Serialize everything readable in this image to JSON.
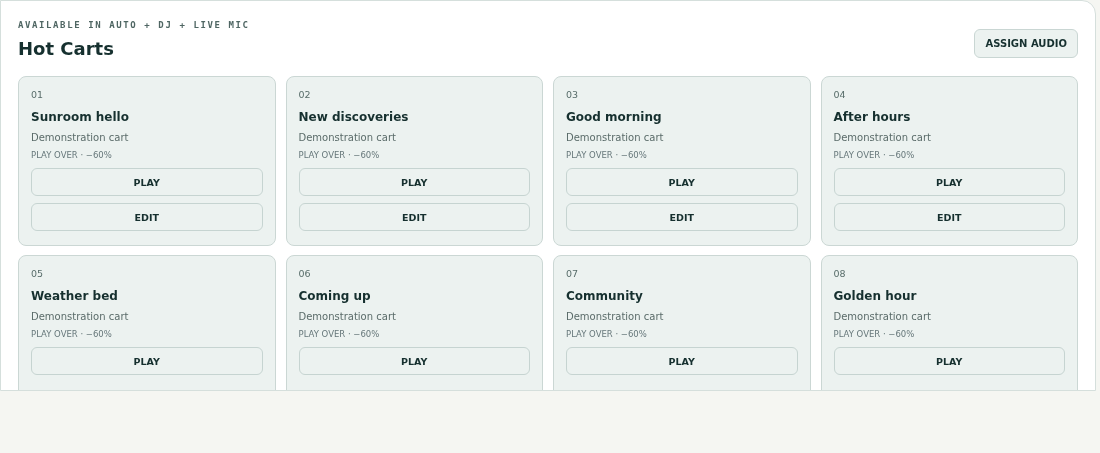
{
  "panel": {
    "eyebrow": "AVAILABLE IN AUTO + DJ + LIVE MIC",
    "title": "Hot Carts",
    "action": "ASSIGN AUDIO"
  },
  "carts": [
    {
      "number": "01",
      "name": "Sunroom hello",
      "description": "Demonstration cart",
      "mode": "PLAY OVER · −60%",
      "buttons": [
        "PLAY",
        "EDIT"
      ]
    },
    {
      "number": "02",
      "name": "New discoveries",
      "description": "Demonstration cart",
      "mode": "PLAY OVER · −60%",
      "buttons": [
        "PLAY",
        "EDIT"
      ]
    },
    {
      "number": "03",
      "name": "Good morning",
      "description": "Demonstration cart",
      "mode": "PLAY OVER · −60%",
      "buttons": [
        "PLAY",
        "EDIT"
      ]
    },
    {
      "number": "04",
      "name": "After hours",
      "description": "Demonstration cart",
      "mode": "PLAY OVER · −60%",
      "buttons": [
        "PLAY",
        "EDIT"
      ]
    },
    {
      "number": "05",
      "name": "Weather bed",
      "description": "Demonstration cart",
      "mode": "PLAY OVER · −60%",
      "buttons": [
        "PLAY"
      ]
    },
    {
      "number": "06",
      "name": "Coming up",
      "description": "Demonstration cart",
      "mode": "PLAY OVER · −60%",
      "buttons": [
        "PLAY"
      ]
    },
    {
      "number": "07",
      "name": "Community",
      "description": "Demonstration cart",
      "mode": "PLAY OVER · −60%",
      "buttons": [
        "PLAY"
      ]
    },
    {
      "number": "08",
      "name": "Golden hour",
      "description": "Demonstration cart",
      "mode": "PLAY OVER · −60%",
      "buttons": [
        "PLAY"
      ]
    }
  ]
}
